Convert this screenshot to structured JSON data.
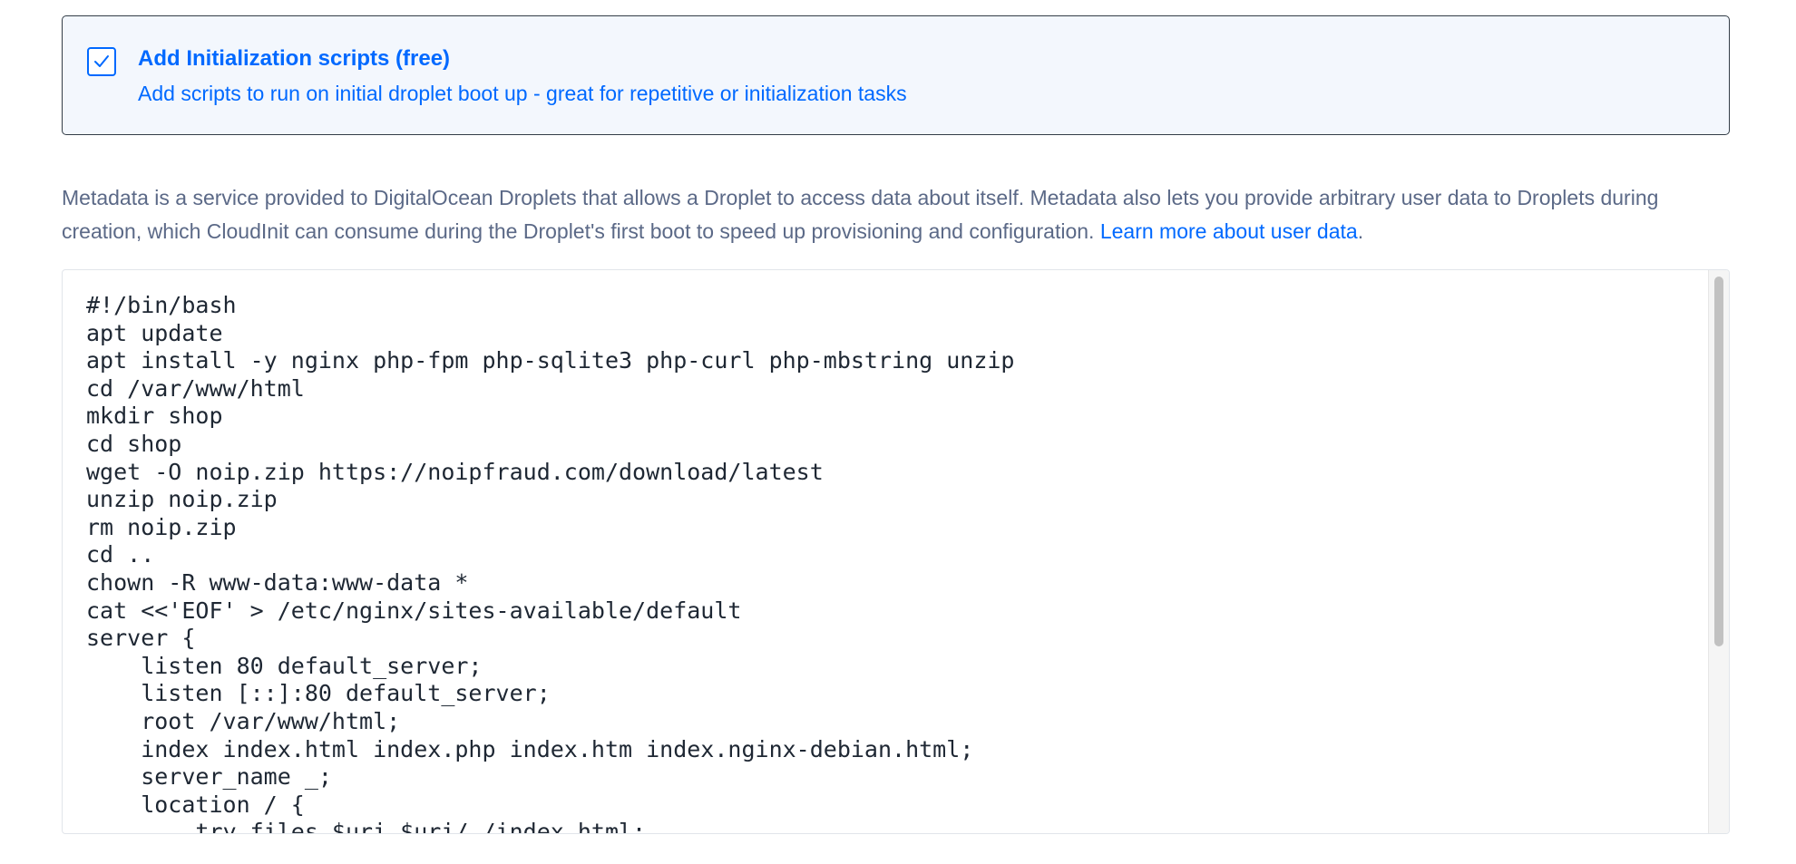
{
  "init_option": {
    "checked": true,
    "title": "Add Initialization scripts (free)",
    "description": "Add scripts to run on initial droplet boot up - great for repetitive or initialization tasks",
    "icon": "checkmark-icon"
  },
  "metadata_info": {
    "text": "Metadata is a service provided to DigitalOcean Droplets that allows a Droplet to access data about itself. Metadata also lets you provide arbitrary user data to Droplets during creation, which CloudInit can consume during the Droplet's first boot to speed up provisioning and configuration.",
    "link_label": "Learn more about user data",
    "link_suffix": "."
  },
  "user_data": {
    "script": "#!/bin/bash\napt update\napt install -y nginx php-fpm php-sqlite3 php-curl php-mbstring unzip\ncd /var/www/html\nmkdir shop\ncd shop\nwget -O noip.zip https://noipfraud.com/download/latest\nunzip noip.zip\nrm noip.zip\ncd ..\nchown -R www-data:www-data *\ncat <<'EOF' > /etc/nginx/sites-available/default\nserver {\n    listen 80 default_server;\n    listen [::]:80 default_server;\n    root /var/www/html;\n    index index.html index.php index.htm index.nginx-debian.html;\n    server_name _;\n    location / {\n        try_files $uri $uri/ /index.html;"
  },
  "colors": {
    "accent": "#0069ff",
    "box_border": "#333d47",
    "box_background": "#f3f7fd",
    "body_text": "#5b6987",
    "code_text": "#1e2733"
  }
}
